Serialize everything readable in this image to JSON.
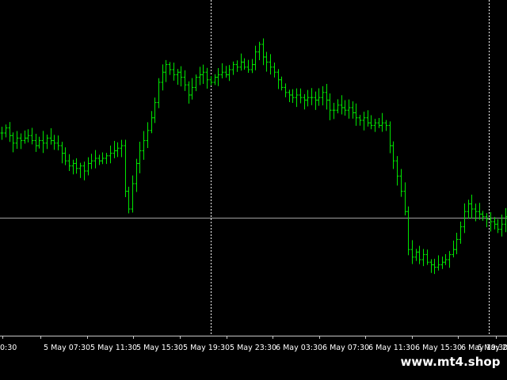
{
  "chart_data": {
    "type": "line",
    "style": "candlestick-bars",
    "title": "",
    "xlabel": "",
    "ylabel": "",
    "grid": false,
    "colors": {
      "background": "#000000",
      "bars": "#00e600",
      "axis": "#c8c8c8",
      "separator": "#ffffff",
      "ask_line": "#a0a0a0",
      "text": "#ffffff"
    },
    "x_tick_labels": [
      "0:30",
      "5 May 07:30",
      "5 May 11:30",
      "5 May 15:30",
      "5 May 19:30",
      "5 May 23:30",
      "6 May 03:30",
      "6 May 07:30",
      "6 May 11:30",
      "6 May 15:30",
      "6 May 19:30",
      "6 May 2"
    ],
    "day_separators": [
      "5 May 23:30",
      "6 May 23:30"
    ],
    "current_price_level": 0.265,
    "series": [
      {
        "values": [
          0.6,
          0.62,
          0.59,
          0.56,
          0.58,
          0.57,
          0.58,
          0.59,
          0.57,
          0.55,
          0.57,
          0.56,
          0.58,
          0.57,
          0.56,
          0.55,
          0.52,
          0.49,
          0.47,
          0.48,
          0.46,
          0.47,
          0.45,
          0.48,
          0.49,
          0.5,
          0.49,
          0.5,
          0.51,
          0.52,
          0.53,
          0.54,
          0.55,
          0.37,
          0.3,
          0.4,
          0.48,
          0.53,
          0.57,
          0.61,
          0.66,
          0.72,
          0.8,
          0.84,
          0.87,
          0.85,
          0.83,
          0.84,
          0.82,
          0.79,
          0.75,
          0.78,
          0.82,
          0.83,
          0.84,
          0.81,
          0.8,
          0.82,
          0.83,
          0.84,
          0.83,
          0.85,
          0.87,
          0.86,
          0.88,
          0.86,
          0.85,
          0.87,
          0.92,
          0.95,
          0.9,
          0.88,
          0.86,
          0.84,
          0.81,
          0.78,
          0.76,
          0.75,
          0.74,
          0.75,
          0.74,
          0.73,
          0.74,
          0.74,
          0.73,
          0.74,
          0.76,
          0.73,
          0.69,
          0.69,
          0.71,
          0.7,
          0.69,
          0.7,
          0.68,
          0.66,
          0.65,
          0.66,
          0.64,
          0.63,
          0.64,
          0.63,
          0.64,
          0.63,
          0.55,
          0.49,
          0.43,
          0.37,
          0.29,
          0.14,
          0.11,
          0.13,
          0.1,
          0.12,
          0.09,
          0.08,
          0.07,
          0.08,
          0.09,
          0.1,
          0.12,
          0.14,
          0.18,
          0.23,
          0.29,
          0.32,
          0.3,
          0.29,
          0.28,
          0.27,
          0.26,
          0.25,
          0.24,
          0.22,
          0.24,
          0.27
        ]
      }
    ]
  },
  "watermark": {
    "text": "www.mt4.shop"
  }
}
